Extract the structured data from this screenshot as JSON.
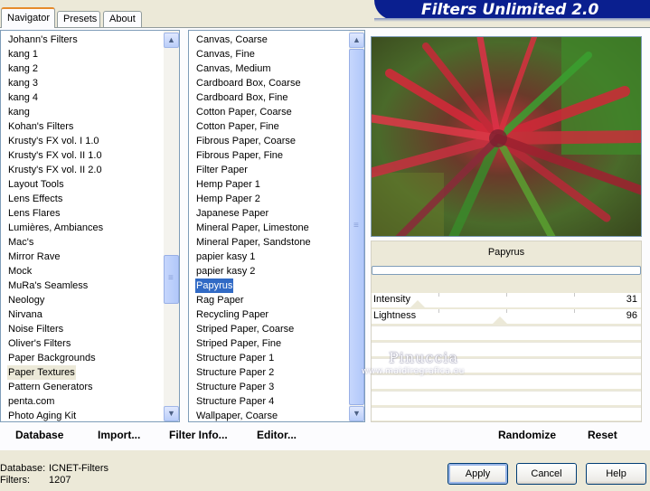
{
  "tabs": [
    {
      "label": "Navigator",
      "active": true
    },
    {
      "label": "Presets",
      "active": false
    },
    {
      "label": "About",
      "active": false
    }
  ],
  "app_title": "Filters Unlimited 2.0",
  "categories": [
    "Johann's Filters",
    "kang 1",
    "kang 2",
    "kang 3",
    "kang 4",
    "kang",
    "Kohan's Filters",
    "Krusty's FX vol. I 1.0",
    "Krusty's FX vol. II 1.0",
    "Krusty's FX vol. II 2.0",
    "Layout Tools",
    "Lens Effects",
    "Lens Flares",
    "Lumières, Ambiances",
    "Mac's",
    "Mirror Rave",
    "Mock",
    "MuRa's Seamless",
    "Neology",
    "Nirvana",
    "Noise Filters",
    "Oliver's Filters",
    "Paper Backgrounds",
    "Paper Textures",
    "Pattern Generators",
    "penta.com",
    "Photo Aging Kit"
  ],
  "selected_category": "Paper Textures",
  "filters": [
    "Canvas, Coarse",
    "Canvas, Fine",
    "Canvas, Medium",
    "Cardboard Box, Coarse",
    "Cardboard Box, Fine",
    "Cotton Paper, Coarse",
    "Cotton Paper, Fine",
    "Fibrous Paper, Coarse",
    "Fibrous Paper, Fine",
    "Filter Paper",
    "Hemp Paper 1",
    "Hemp Paper 2",
    "Japanese Paper",
    "Mineral Paper, Limestone",
    "Mineral Paper, Sandstone",
    "papier kasy 1",
    "papier kasy 2",
    "Papyrus",
    "Rag Paper",
    "Recycling Paper",
    "Striped Paper, Coarse",
    "Striped Paper, Fine",
    "Structure Paper 1",
    "Structure Paper 2",
    "Structure Paper 3",
    "Structure Paper 4",
    "Wallpaper, Coarse"
  ],
  "selected_filter": "Papyrus",
  "current_filter_name": "Papyrus",
  "params": [
    {
      "label": "Intensity",
      "value": "31",
      "level": 31
    },
    {
      "label": "Lightness",
      "value": "96",
      "level": 96
    }
  ],
  "watermark": {
    "name": "Pinuccia",
    "url": "www.maidiregrafica.eu"
  },
  "toolbar": {
    "database": "Database",
    "import": "Import...",
    "filter_info": "Filter Info...",
    "editor": "Editor...",
    "randomize": "Randomize",
    "reset": "Reset"
  },
  "footer": {
    "database_label": "Database:",
    "database_value": "ICNET-Filters",
    "filters_label": "Filters:",
    "filters_value": "1207"
  },
  "buttons": {
    "apply": "Apply",
    "cancel": "Cancel",
    "help": "Help"
  },
  "colors": {
    "title_banner": "#0a1f8f",
    "selection": "#316ac5",
    "tab_accent": "#e68b2c"
  }
}
